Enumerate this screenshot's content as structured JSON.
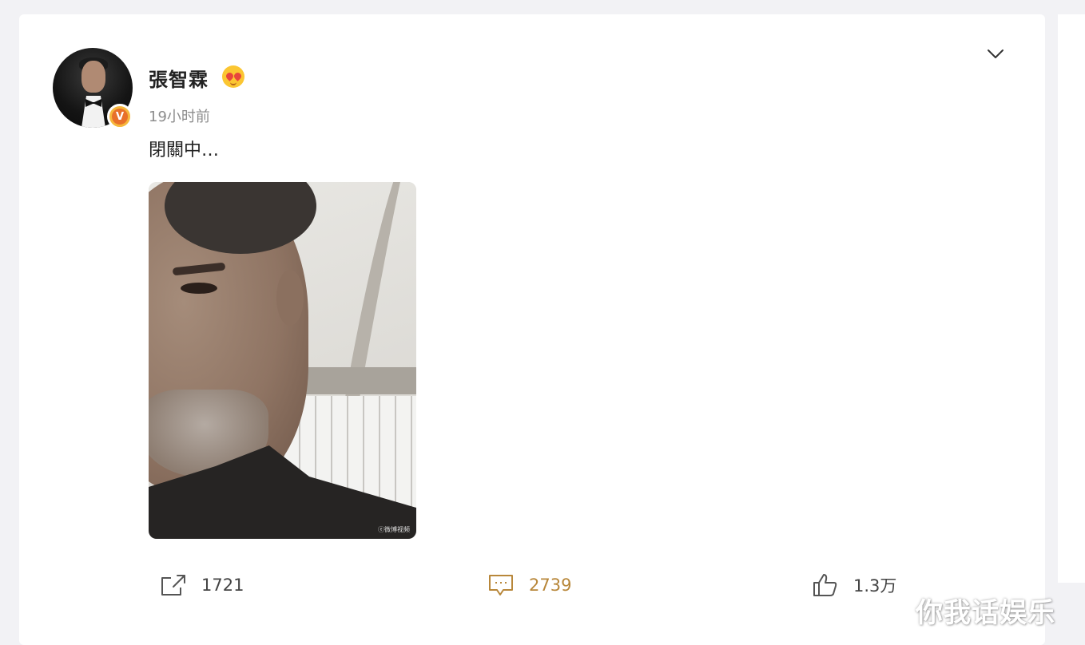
{
  "post": {
    "username": "張智霖",
    "timestamp": "19小时前",
    "text": "閉關中…",
    "photo_watermark": "ⓔ微博视频"
  },
  "actions": {
    "share_count": "1721",
    "comment_count": "2739",
    "like_count": "1.3万"
  },
  "icons": {
    "verified": "verified-v-badge-icon",
    "member_badge": "heart-eyes-emoji-icon",
    "more": "chevron-down-icon",
    "share": "share-arrow-icon",
    "comment": "comment-bubble-icon",
    "like": "thumbs-up-icon"
  },
  "colors": {
    "verified_badge": "#f6b73c",
    "comment_accent": "#b8873a",
    "text_primary": "#222222",
    "text_secondary": "#8c8c8c"
  },
  "corner_watermark": "你我话娱乐"
}
